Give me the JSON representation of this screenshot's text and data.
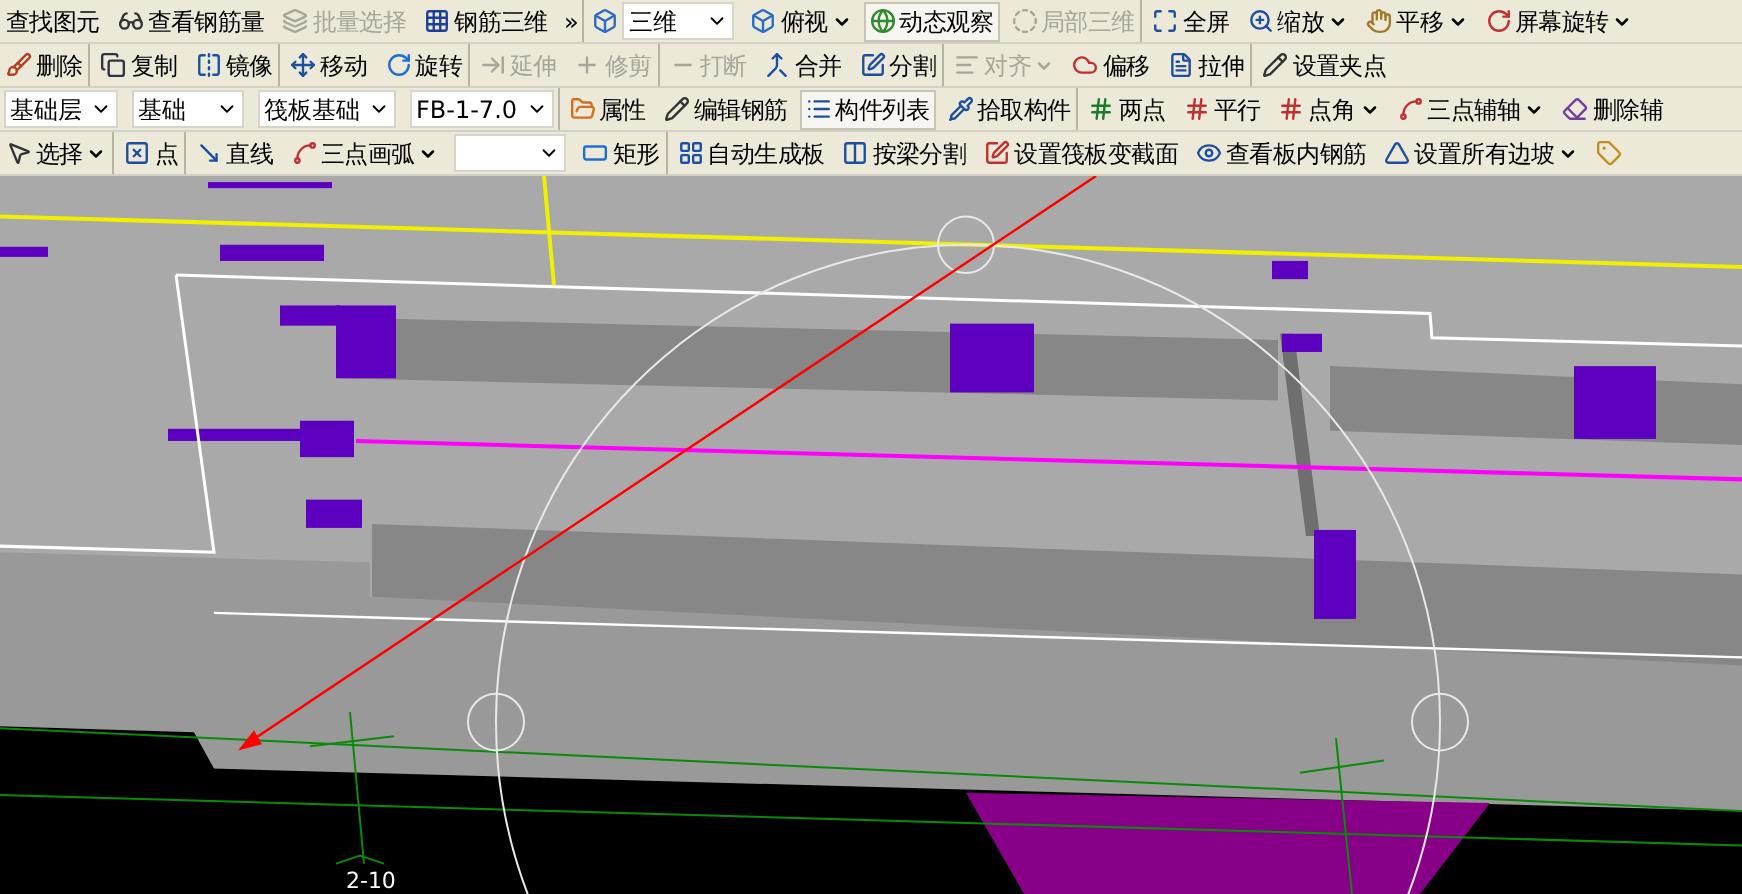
{
  "toolbars": [
    {
      "groups": [
        [
          {
            "kind": "button",
            "label": "查找图元",
            "disabled": false,
            "pressed": false,
            "menu": false
          },
          {
            "kind": "button",
            "label": "查看钢筋量",
            "disabled": false,
            "pressed": false,
            "menu": false
          },
          {
            "kind": "button",
            "label": "批量选择",
            "disabled": true,
            "pressed": false,
            "menu": false
          },
          {
            "kind": "button",
            "label": "钢筋三维",
            "disabled": false,
            "pressed": false,
            "menu": false
          },
          {
            "kind": "overflow",
            "label": "»"
          }
        ],
        [
          {
            "kind": "select",
            "value": "三维"
          },
          {
            "kind": "button",
            "label": "俯视",
            "disabled": false,
            "pressed": false,
            "menu": true
          },
          {
            "kind": "button",
            "label": "动态观察",
            "disabled": false,
            "pressed": true,
            "menu": false
          },
          {
            "kind": "button",
            "label": "局部三维",
            "disabled": true,
            "pressed": false,
            "menu": false
          }
        ],
        [
          {
            "kind": "button",
            "label": "全屏",
            "disabled": false,
            "pressed": false,
            "menu": false
          },
          {
            "kind": "button",
            "label": "缩放",
            "disabled": false,
            "pressed": false,
            "menu": true
          },
          {
            "kind": "button",
            "label": "平移",
            "disabled": false,
            "pressed": false,
            "menu": true
          },
          {
            "kind": "button",
            "label": "屏幕旋转",
            "disabled": false,
            "pressed": false,
            "menu": true
          }
        ]
      ]
    },
    {
      "groups": [
        [
          {
            "kind": "button",
            "label": "删除",
            "disabled": false,
            "pressed": false,
            "menu": false
          }
        ],
        [
          {
            "kind": "button",
            "label": "复制",
            "disabled": false,
            "pressed": false,
            "menu": false
          },
          {
            "kind": "button",
            "label": "镜像",
            "disabled": false,
            "pressed": false,
            "menu": false
          }
        ],
        [
          {
            "kind": "button",
            "label": "移动",
            "disabled": false,
            "pressed": false,
            "menu": false
          },
          {
            "kind": "button",
            "label": "旋转",
            "disabled": false,
            "pressed": false,
            "menu": false
          }
        ],
        [
          {
            "kind": "button",
            "label": "延伸",
            "disabled": true,
            "pressed": false,
            "menu": false
          },
          {
            "kind": "button",
            "label": "修剪",
            "disabled": true,
            "pressed": false,
            "menu": false
          }
        ],
        [
          {
            "kind": "button",
            "label": "打断",
            "disabled": true,
            "pressed": false,
            "menu": false
          },
          {
            "kind": "button",
            "label": "合并",
            "disabled": false,
            "pressed": false,
            "menu": false
          },
          {
            "kind": "button",
            "label": "分割",
            "disabled": false,
            "pressed": false,
            "menu": false
          }
        ],
        [
          {
            "kind": "button",
            "label": "对齐",
            "disabled": true,
            "pressed": false,
            "menu": true
          },
          {
            "kind": "button",
            "label": "偏移",
            "disabled": false,
            "pressed": false,
            "menu": false
          },
          {
            "kind": "button",
            "label": "拉伸",
            "disabled": false,
            "pressed": false,
            "menu": false
          }
        ],
        [
          {
            "kind": "button",
            "label": "设置夹点",
            "disabled": false,
            "pressed": false,
            "menu": false
          }
        ]
      ]
    },
    {
      "groups": [
        [
          {
            "kind": "select",
            "value": "基础层"
          },
          {
            "kind": "select",
            "value": "基础"
          },
          {
            "kind": "select",
            "value": "筏板基础"
          },
          {
            "kind": "select",
            "value": "FB-1-7.0"
          }
        ],
        [
          {
            "kind": "button",
            "label": "属性",
            "disabled": false,
            "pressed": false,
            "menu": false
          },
          {
            "kind": "button",
            "label": "编辑钢筋",
            "disabled": false,
            "pressed": false,
            "menu": false
          },
          {
            "kind": "button",
            "label": "构件列表",
            "disabled": false,
            "pressed": true,
            "menu": false
          },
          {
            "kind": "button",
            "label": "拾取构件",
            "disabled": false,
            "pressed": false,
            "menu": false
          }
        ],
        [
          {
            "kind": "button",
            "label": "两点",
            "disabled": false,
            "pressed": false,
            "menu": false
          },
          {
            "kind": "button",
            "label": "平行",
            "disabled": false,
            "pressed": false,
            "menu": false
          },
          {
            "kind": "button",
            "label": "点角",
            "disabled": false,
            "pressed": false,
            "menu": true
          },
          {
            "kind": "button",
            "label": "三点辅轴",
            "disabled": false,
            "pressed": false,
            "menu": true
          },
          {
            "kind": "button",
            "label": "删除辅",
            "disabled": false,
            "pressed": false,
            "menu": false
          }
        ]
      ]
    },
    {
      "groups": [
        [
          {
            "kind": "button",
            "label": "选择",
            "disabled": false,
            "pressed": false,
            "menu": true
          }
        ],
        [
          {
            "kind": "button",
            "label": "点",
            "disabled": false,
            "pressed": false,
            "menu": false
          }
        ],
        [
          {
            "kind": "button",
            "label": "直线",
            "disabled": false,
            "pressed": false,
            "menu": false
          },
          {
            "kind": "button",
            "label": "三点画弧",
            "disabled": false,
            "pressed": false,
            "menu": true
          },
          {
            "kind": "select"
          },
          {
            "kind": "button",
            "label": "矩形",
            "disabled": false,
            "pressed": false,
            "menu": false
          }
        ],
        [
          {
            "kind": "button",
            "label": "自动生成板",
            "disabled": false,
            "pressed": false,
            "menu": false
          },
          {
            "kind": "button",
            "label": "按梁分割",
            "disabled": false,
            "pressed": false,
            "menu": false
          },
          {
            "kind": "button",
            "label": "设置筏板变截面",
            "disabled": false,
            "pressed": false,
            "menu": false
          },
          {
            "kind": "button",
            "label": "查看板内钢筋",
            "disabled": false,
            "pressed": false,
            "menu": false
          },
          {
            "kind": "button",
            "label": "设置所有边坡",
            "disabled": false,
            "pressed": false,
            "menu": true
          },
          {
            "kind": "button",
            "disabled": false,
            "pressed": false,
            "menu": false
          }
        ]
      ]
    }
  ],
  "canvas": {
    "axis_label": "2-10"
  }
}
